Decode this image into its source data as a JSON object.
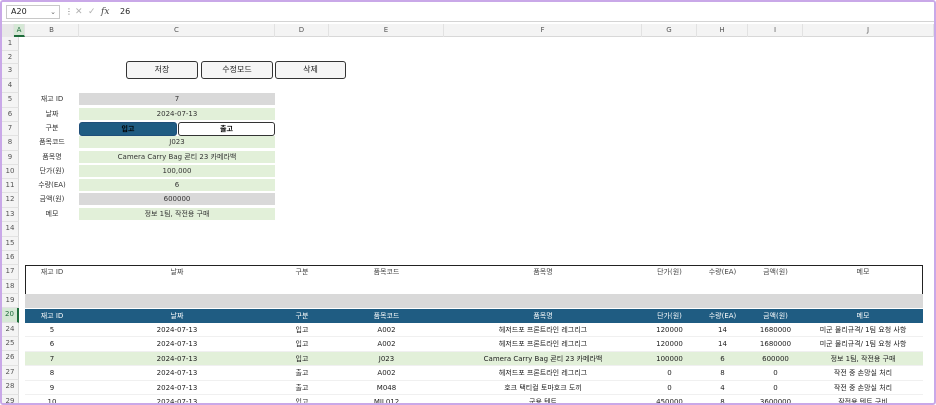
{
  "formula_bar": {
    "cell_ref": "A20",
    "separator": "⋮",
    "cancel_icon": "✕",
    "confirm_icon": "✓",
    "fx_label": "fx",
    "value": "26"
  },
  "columns": [
    "A",
    "B",
    "C",
    "D",
    "E",
    "F",
    "G",
    "H",
    "I",
    "J"
  ],
  "selected_column": "A",
  "rows": [
    "1",
    "2",
    "3",
    "4",
    "5",
    "6",
    "7",
    "8",
    "9",
    "10",
    "11",
    "12",
    "13",
    "14",
    "15",
    "16",
    "17",
    "18",
    "19",
    "20",
    "24",
    "25",
    "26",
    "27",
    "28",
    "29"
  ],
  "selected_row": "20",
  "buttons": {
    "save": "저장",
    "edit_mode": "수정모드",
    "delete": "삭제"
  },
  "form": {
    "fields": [
      {
        "label": "재고 ID",
        "value": "7",
        "style": "gray"
      },
      {
        "label": "날짜",
        "value": "2024-07-13",
        "style": "green"
      },
      {
        "label": "구분",
        "value": "",
        "style": "toggle"
      },
      {
        "label": "품목코드",
        "value": "J023",
        "style": "green"
      },
      {
        "label": "품목명",
        "value": "Camera Carry Bag 쿈티 23 카메라백",
        "style": "green"
      },
      {
        "label": "단가(원)",
        "value": "100,000",
        "style": "green"
      },
      {
        "label": "수량(EA)",
        "value": "6",
        "style": "green"
      },
      {
        "label": "금액(원)",
        "value": "600000",
        "style": "gray"
      },
      {
        "label": "메모",
        "value": "정보 1팀, 작전용 구매",
        "style": "green"
      }
    ],
    "toggle": {
      "in_label": "입고",
      "out_label": "출고",
      "selected": "입고"
    }
  },
  "table": {
    "headers": [
      "재고 ID",
      "날짜",
      "구분",
      "품목코드",
      "품목명",
      "단가(원)",
      "수량(EA)",
      "금액(원)",
      "메모"
    ],
    "rows": [
      {
        "highlight": false,
        "cells": [
          "5",
          "2024-07-13",
          "입고",
          "A002",
          "헤저드포 프론트라인 레그리그",
          "120000",
          "14",
          "1680000",
          "미군 물리규격/ 1팀 요청 사항"
        ]
      },
      {
        "highlight": false,
        "cells": [
          "6",
          "2024-07-13",
          "입고",
          "A002",
          "헤저드포 프론트라인 레그리그",
          "120000",
          "14",
          "1680000",
          "미군 물리규격/ 1팀 요청 사항"
        ]
      },
      {
        "highlight": true,
        "cells": [
          "7",
          "2024-07-13",
          "입고",
          "J023",
          "Camera Carry Bag 쿈티 23 카메라백",
          "100000",
          "6",
          "600000",
          "정보 1팀, 작전용 구매"
        ]
      },
      {
        "highlight": false,
        "cells": [
          "8",
          "2024-07-13",
          "출고",
          "A002",
          "헤저드포 프론트라인 레그리그",
          "0",
          "8",
          "0",
          "작전 중 손망실 처리"
        ]
      },
      {
        "highlight": false,
        "cells": [
          "9",
          "2024-07-13",
          "출고",
          "M048",
          "호크 택티컬 토마호크 도끼",
          "0",
          "4",
          "0",
          "작전 중 손망실 처리"
        ]
      },
      {
        "highlight": false,
        "cells": [
          "10",
          "2024-07-13",
          "입고",
          "MIL012",
          "군용 텐트",
          "450000",
          "8",
          "3600000",
          "작전용 텐트 구비"
        ]
      }
    ]
  }
}
